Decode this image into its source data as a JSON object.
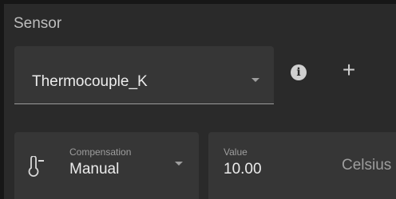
{
  "section": {
    "title": "Sensor"
  },
  "sensor_select": {
    "value": "Thermocouple_K",
    "dropdown_icon": "chevron-down-icon"
  },
  "actions": {
    "info_icon": "info-icon",
    "info_glyph": "i",
    "add_icon": "plus-icon",
    "add_glyph": "+"
  },
  "compensation": {
    "label": "Compensation",
    "value": "Manual",
    "icon": "thermometer-minus-icon"
  },
  "value_field": {
    "label": "Value",
    "value": "10.00",
    "unit": "Celsius"
  },
  "colors": {
    "background": "#2a2a2a",
    "field": "#363636",
    "text": "#ececec",
    "muted": "#9e9e9e"
  }
}
